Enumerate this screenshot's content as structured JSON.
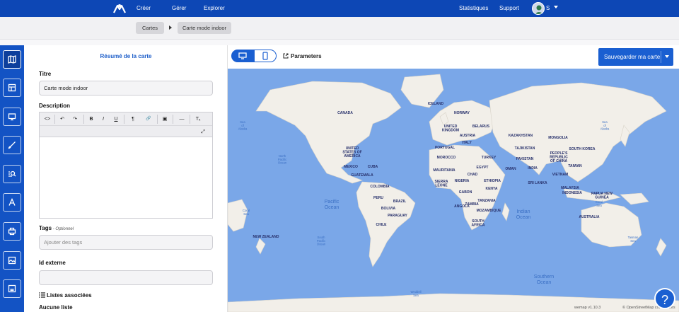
{
  "nav": {
    "links": [
      "Créer",
      "Gérer",
      "Explorer"
    ],
    "right_links": [
      "Statistiques",
      "Support"
    ],
    "user_initial": "S"
  },
  "breadcrumb": [
    "Cartes",
    "Carte mode indoor"
  ],
  "panel": {
    "title": "Résumé de la carte",
    "title_label": "Titre",
    "title_value": "Carte mode indoor",
    "description_label": "Description",
    "tags_label": "Tags",
    "tags_optional": " - Optionnel",
    "tags_placeholder": "Ajouter des tags",
    "external_id_label": "Id externe",
    "external_id_value": "",
    "lists_title": "Listes associées",
    "lists_empty": "Aucune liste"
  },
  "editor_toolbar": [
    "<>",
    "↶",
    "↷",
    "B",
    "I",
    "U",
    "¶",
    "🔗",
    "▣",
    "—",
    "Tₓ",
    "⤢"
  ],
  "toolbar": {
    "params_label": "Parameters",
    "save_label": "Sauvegarder ma carte"
  },
  "map": {
    "labels": [
      "CANADA",
      "ICELAND",
      "NORWAY",
      "UNITED KINGDOM",
      "BELARUS",
      "AUSTRIA",
      "ITALY",
      "PORTUGAL",
      "MOROCCO",
      "MAURITANIA",
      "SIERRA LEONE",
      "NIGERIA",
      "CHAD",
      "GABON",
      "ANGOLA",
      "TANZANIA",
      "ZAMBIA",
      "MOZAMBIQUE",
      "SOUTH AFRICA",
      "EGYPT",
      "ETHIOPIA",
      "KENYA",
      "TURKEY",
      "OMAN",
      "KAZAKHSTAN",
      "TAJIKISTAN",
      "PAKISTAN",
      "INDIA",
      "SRI LANKA",
      "MONGOLIA",
      "PEOPLE'S REPUBLIC OF CHINA",
      "SOUTH KOREA",
      "TAIWAN",
      "VIETNAM",
      "MALAYSIA",
      "INDONESIA",
      "PAPUA NEW GUINEA",
      "AUSTRALIA",
      "NEW ZEALAND",
      "UNITED STATES OF AMERICA",
      "MEXICO",
      "CUBA",
      "GUATEMALA",
      "COLOMBIA",
      "PERU",
      "BRAZIL",
      "BOLIVIA",
      "PARAGUAY",
      "CHILE"
    ],
    "oceans": [
      "Pacific Ocean",
      "Indian Ocean",
      "Southern Ocean",
      "Pacific Ocean"
    ],
    "seas": [
      "Sea of Alaska",
      "Sea of Alaska",
      "North Pacific Ocean",
      "South Pacific Ocean",
      "Coral Sea",
      "Tasman Sea",
      "Weddell Sea",
      "Coral Sea"
    ],
    "attribution": "© OpenStreetMap contributors",
    "brand": "wemap v1.10.3"
  },
  "help_label": "?"
}
